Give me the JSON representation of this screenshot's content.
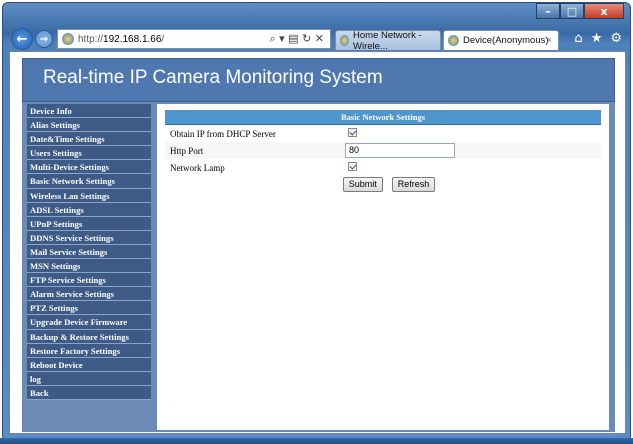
{
  "browser": {
    "url_prefix": "http://",
    "url_host": "192.168.1.66",
    "url_suffix": "/",
    "address_tools": "⌕ ▾ ▤ ↻ ✕",
    "tabs": [
      {
        "label": "Home Network - Wirele..."
      },
      {
        "label": "Device(Anonymous)",
        "close": "×"
      }
    ],
    "window_controls": {
      "minimize": "–",
      "maximize": "□",
      "close": "x"
    }
  },
  "page": {
    "title": "Real-time IP Camera Monitoring System"
  },
  "sidebar": {
    "items": [
      {
        "label": "Device Info"
      },
      {
        "label": "Alias Settings"
      },
      {
        "label": "Date&Time Settings"
      },
      {
        "label": "Users Settings"
      },
      {
        "label": "Multi-Device Settings"
      },
      {
        "label": "Basic Network Settings"
      },
      {
        "label": "Wireless Lan Settings"
      },
      {
        "label": "ADSL Settings"
      },
      {
        "label": "UPnP Settings"
      },
      {
        "label": "DDNS Service Settings"
      },
      {
        "label": "Mail Service Settings"
      },
      {
        "label": "MSN Settings"
      },
      {
        "label": "FTP Service Settings"
      },
      {
        "label": "Alarm Service Settings"
      },
      {
        "label": "PTZ Settings"
      },
      {
        "label": "Upgrade Device Firmware"
      },
      {
        "label": "Backup & Restore Settings"
      },
      {
        "label": "Restore Factory Settings"
      },
      {
        "label": "Reboot Device"
      },
      {
        "label": "log"
      },
      {
        "label": "Back"
      }
    ]
  },
  "settings": {
    "title": "Basic Network Settings",
    "dhcp": {
      "label": "Obtain IP from DHCP Server",
      "checked": true
    },
    "http_port": {
      "label": "Http Port",
      "value": "80"
    },
    "network_lamp": {
      "label": "Network Lamp",
      "checked": true
    },
    "submit_label": "Submit",
    "refresh_label": "Refresh"
  },
  "colors": {
    "header_bg": "#4f78b0",
    "sidebar_bg": "#3e5b87",
    "section_title_bg": "#4f96cc"
  }
}
